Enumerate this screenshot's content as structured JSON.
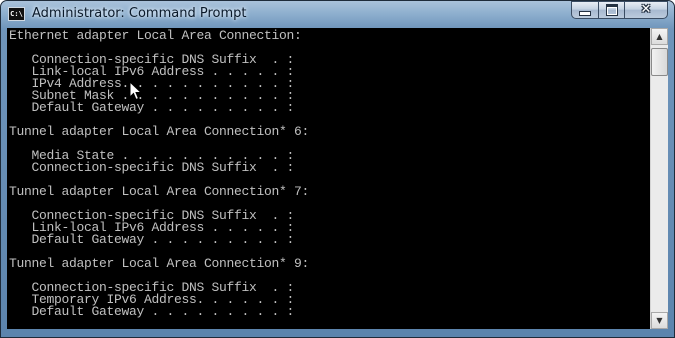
{
  "window": {
    "title": "Administrator: Command Prompt",
    "icon_text": "C:\\",
    "icon": "cmd-icon",
    "buttons": {
      "minimize": "minimize-icon",
      "maximize": "maximize-icon",
      "close": "close-icon"
    }
  },
  "console": {
    "lines": [
      "Ethernet adapter Local Area Connection:",
      "",
      "   Connection-specific DNS Suffix  . :",
      "   Link-local IPv6 Address . . . . . :",
      "   IPv4 Address. . . . . . . . . . . :",
      "   Subnet Mask . . . . . . . . . . . :",
      "   Default Gateway . . . . . . . . . :",
      "",
      "Tunnel adapter Local Area Connection* 6:",
      "",
      "   Media State . . . . . . . . . . . :",
      "   Connection-specific DNS Suffix  . :",
      "",
      "Tunnel adapter Local Area Connection* 7:",
      "",
      "   Connection-specific DNS Suffix  . :",
      "   Link-local IPv6 Address . . . . . :",
      "   Default Gateway . . . . . . . . . :",
      "",
      "Tunnel adapter Local Area Connection* 9:",
      "",
      "   Connection-specific DNS Suffix  . :",
      "   Temporary IPv6 Address. . . . . . :",
      "   Default Gateway . . . . . . . . . :"
    ],
    "text_color": "#c0c0c0",
    "background": "#000000"
  },
  "scrollbar": {
    "up": "scroll-up-arrow-icon",
    "down": "scroll-down-arrow-icon"
  }
}
